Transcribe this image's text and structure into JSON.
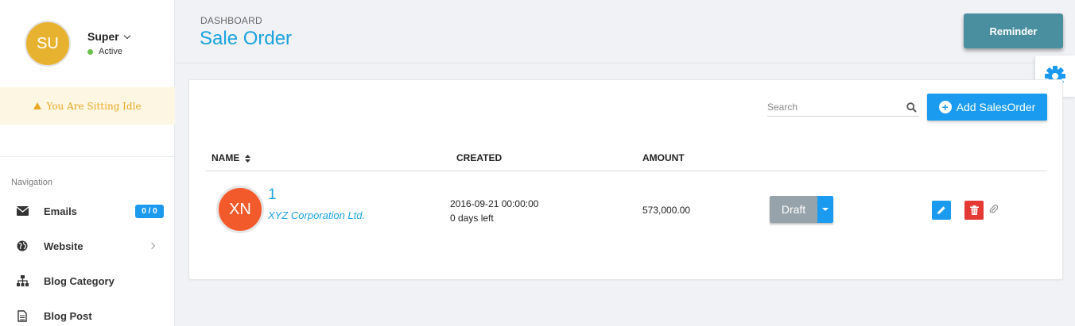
{
  "user": {
    "initials": "SU",
    "name": "Super",
    "status": "Active",
    "avatar_color": "#e8b231",
    "status_color": "#6cc04a"
  },
  "idle_banner": "You Are Sitting Idle",
  "navigation": {
    "header": "Navigation",
    "items": [
      {
        "label": "Emails",
        "icon": "envelope-icon",
        "badge": "0 / 0"
      },
      {
        "label": "Website",
        "icon": "globe-icon",
        "has_arrow": true
      },
      {
        "label": "Blog Category",
        "icon": "sitemap-icon"
      },
      {
        "label": "Blog Post",
        "icon": "document-icon"
      }
    ]
  },
  "header": {
    "breadcrumb": "DASHBOARD",
    "title": "Sale Order",
    "reminder_label": "Reminder"
  },
  "toolbar": {
    "search_placeholder": "Search",
    "add_label": "Add SalesOrder"
  },
  "table": {
    "columns": [
      "NAME",
      "CREATED",
      "AMOUNT"
    ],
    "rows": [
      {
        "initials": "XN",
        "number": "1",
        "company": "XYZ Corporation Ltd.",
        "created_date": "2016-09-21 00:00:00",
        "created_relative": "0 days left",
        "amount": "573,000.00",
        "status": "Draft"
      }
    ]
  },
  "colors": {
    "accent": "#1ba3e0",
    "primary_button": "#1a9bf0",
    "reminder": "#4a8fa0",
    "danger": "#e53935",
    "draft": "#96a3ab",
    "row_avatar": "#f25a2b"
  }
}
